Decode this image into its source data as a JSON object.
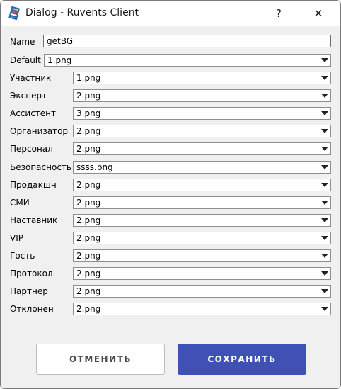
{
  "window": {
    "title": "Dialog - Ruvents Client",
    "help_glyph": "?",
    "close_glyph": "✕",
    "app_icon": "ruvents-app-icon"
  },
  "form": {
    "name_label": "Name",
    "name_value": "getBG",
    "default_label": "Default",
    "default_value": "1.png",
    "roles": [
      {
        "label": "Участник",
        "value": "1.png"
      },
      {
        "label": "Эксперт",
        "value": "2.png"
      },
      {
        "label": "Ассистент",
        "value": "3.png"
      },
      {
        "label": "Организатор",
        "value": "2.png"
      },
      {
        "label": "Персонал",
        "value": "2.png"
      },
      {
        "label": "Безопасность",
        "value": "ssss.png"
      },
      {
        "label": "Продакшн",
        "value": "2.png"
      },
      {
        "label": "СМИ",
        "value": "2.png"
      },
      {
        "label": "Наставник",
        "value": "2.png"
      },
      {
        "label": "VIP",
        "value": "2.png"
      },
      {
        "label": "Гость",
        "value": "2.png"
      },
      {
        "label": "Протокол",
        "value": "2.png"
      },
      {
        "label": "Партнер",
        "value": "2.png"
      },
      {
        "label": "Отклонен",
        "value": "2.png"
      }
    ]
  },
  "buttons": {
    "cancel_label": "ОТМЕНИТЬ",
    "save_label": "СОХРАНИТЬ"
  },
  "colors": {
    "accent": "#3f51b5",
    "background": "#f0f0f0"
  }
}
